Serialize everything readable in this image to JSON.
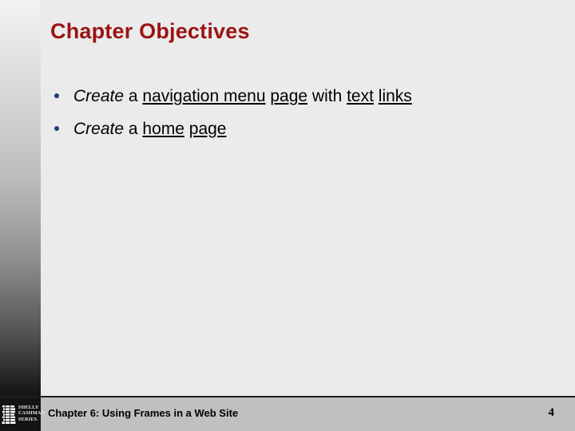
{
  "slide": {
    "title": "Chapter Objectives",
    "title_color": "#9b1313",
    "background_color": "#ebebeb",
    "bullet_color": "#1f3a78"
  },
  "bullets": [
    {
      "segments": [
        {
          "text": "Create",
          "style": "italic"
        },
        {
          "text": " a ",
          "style": "plain"
        },
        {
          "text": "navigation",
          "style": "underline"
        },
        {
          "text": " ",
          "style": "underline"
        },
        {
          "text": "menu",
          "style": "underline"
        },
        {
          "text": " ",
          "style": "plain"
        },
        {
          "text": "page",
          "style": "underline"
        },
        {
          "text": " with ",
          "style": "plain"
        },
        {
          "text": "text",
          "style": "underline"
        },
        {
          "text": " ",
          "style": "plain"
        },
        {
          "text": "links",
          "style": "underline"
        }
      ]
    },
    {
      "segments": [
        {
          "text": "Create",
          "style": "italic"
        },
        {
          "text": " a ",
          "style": "plain"
        },
        {
          "text": "home",
          "style": "underline"
        },
        {
          "text": " ",
          "style": "plain"
        },
        {
          "text": "page",
          "style": "underline"
        }
      ]
    }
  ],
  "footer": {
    "text": "Chapter 6: Using Frames in a Web Site",
    "page_number": "4",
    "band_color": "#c0c0c0",
    "logo": {
      "icon": "stacked-books-icon",
      "lines": [
        "Shelly",
        "Cashman",
        "Series."
      ]
    }
  }
}
